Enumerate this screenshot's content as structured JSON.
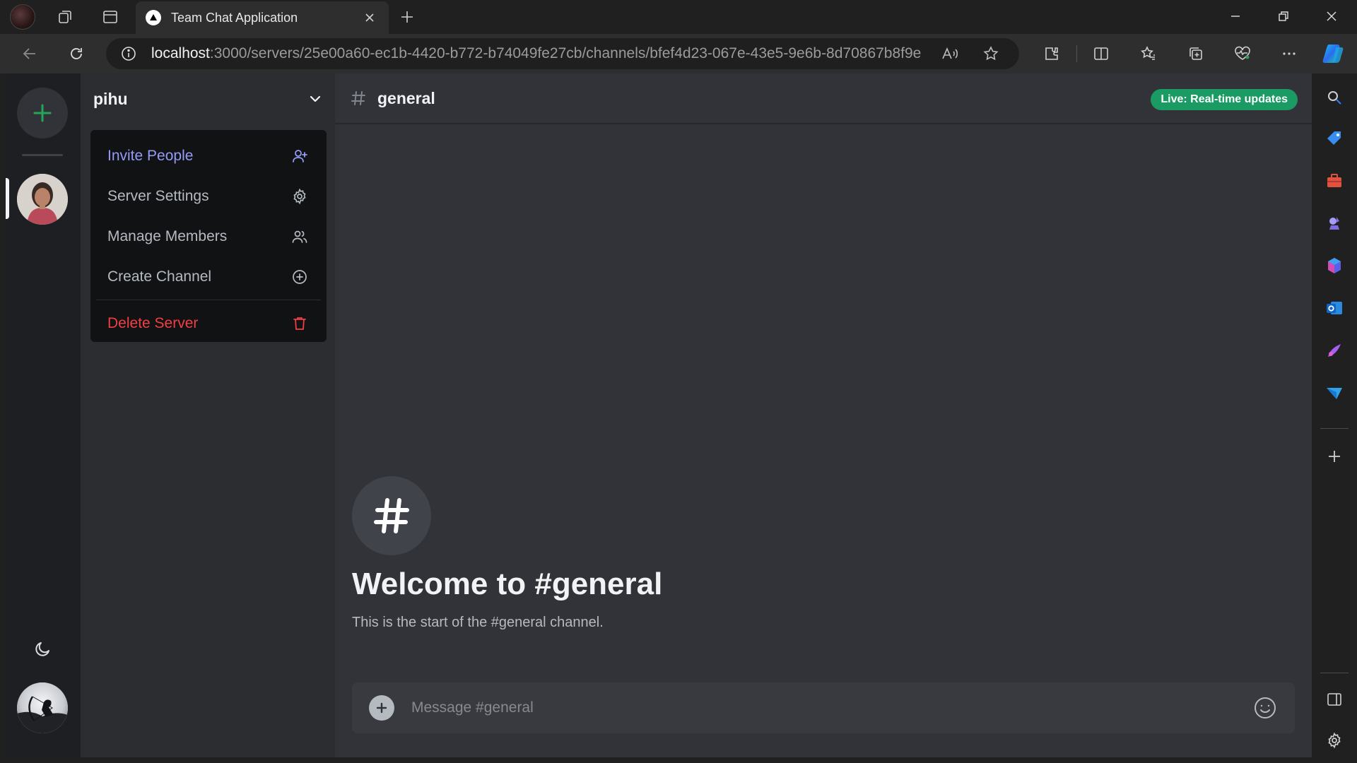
{
  "browser": {
    "tab_title": "Team Chat Application",
    "url_host": "localhost",
    "url_path": ":3000/servers/25e00a60-ec1b-4420-b772-b74049fe27cb/channels/bfef4d23-067e-43e5-9e6b-8d70867b8f9e"
  },
  "server": {
    "name": "pihu"
  },
  "menu": {
    "items": [
      {
        "label": "Invite People",
        "icon": "user-plus-icon"
      },
      {
        "label": "Server Settings",
        "icon": "gear-icon"
      },
      {
        "label": "Manage Members",
        "icon": "users-icon"
      },
      {
        "label": "Create Channel",
        "icon": "plus-circle-icon"
      },
      {
        "label": "Delete Server",
        "icon": "trash-icon"
      }
    ]
  },
  "channel": {
    "name": "general",
    "live_badge": "Live: Real-time updates",
    "welcome_title": "Welcome to #general",
    "welcome_subtitle": "This is the start of the #general channel."
  },
  "composer": {
    "placeholder": "Message #general"
  },
  "colors": {
    "accent_green": "#23a55a",
    "invite": "#949cf7",
    "danger": "#f23f43",
    "live_badge": "#1a9b63"
  }
}
